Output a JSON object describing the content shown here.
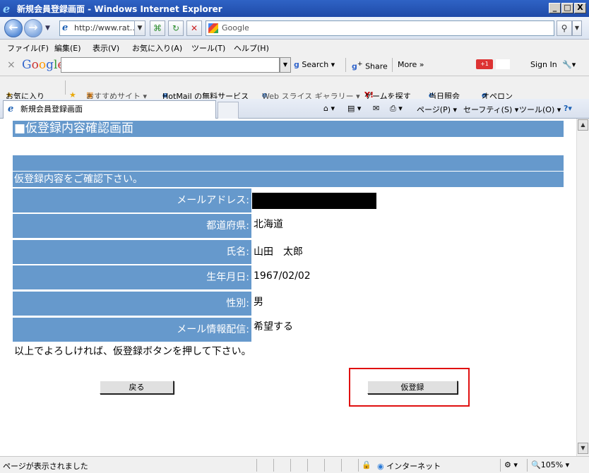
{
  "window": {
    "title": "新規会員登録画面 - Windows Internet Explorer",
    "min": "_",
    "max": "□",
    "close": "X"
  },
  "nav": {
    "back": "←",
    "forward": "→",
    "address": "http://www.rat...",
    "search_placeholder": "Google",
    "search_go": "⚲"
  },
  "menu": {
    "file": "ファイル(F)",
    "edit": "編集(E)",
    "view": "表示(V)",
    "favorites": "お気に入り(A)",
    "tools": "ツール(T)",
    "help": "ヘルプ(H)"
  },
  "google_toolbar": {
    "close": "×",
    "logo": "Google",
    "search": "Search",
    "share": "Share",
    "more": "More »",
    "badge": "+1",
    "signin": "Sign In"
  },
  "favorites_bar": {
    "favorites": "お気に入り",
    "items": [
      "おすすめサイト ▾",
      "HotMail の無料サービス",
      "Web スライス ギャラリー ▾",
      "ゲームを探す",
      "当日照会",
      "オペロン"
    ]
  },
  "tab": {
    "title": "新規会員登録画面"
  },
  "commands": {
    "page": "ページ(P) ▾",
    "safety": "セーフティ(S) ▾",
    "tools": "ツール(O) ▾"
  },
  "page": {
    "header": "■仮登録内容確認画面",
    "subheader": "仮登録内容をご確認下さい。",
    "rows": [
      {
        "label": "メールアドレス:",
        "value": ""
      },
      {
        "label": "都道府県:",
        "value": "北海道"
      },
      {
        "label": "氏名:",
        "value": "山田　太郎"
      },
      {
        "label": "生年月日:",
        "value": "1967/02/02"
      },
      {
        "label": "性別:",
        "value": "男"
      },
      {
        "label": "メール情報配信:",
        "value": "希望する"
      }
    ],
    "note": "以上でよろしければ、仮登録ボタンを押して下さい。",
    "back_button": "戻る",
    "register_button": "仮登録"
  },
  "status": {
    "text": "ページが表示されました",
    "zone": "インターネット",
    "zoom": "105%"
  },
  "colors": {
    "accent": "#6699cc",
    "highlight": "#e01010"
  }
}
